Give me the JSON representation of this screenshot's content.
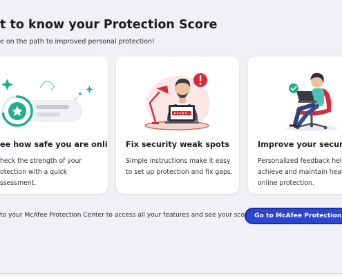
{
  "header": {
    "title": "t to know your Protection Score",
    "subtitle": "e on the path to improved personal protection!"
  },
  "cards": [
    {
      "heading": "ee how safe you are online",
      "body_lines": [
        "heck the strength of your",
        "otection with a quick",
        "ssessment."
      ],
      "illustration": "score-dial-icon"
    },
    {
      "heading": "Fix security weak spots",
      "body_lines": [
        "Simple instructions make it easy",
        "to set up protection and fix gaps."
      ],
      "illustration": "person-at-laptop-alert-icon"
    },
    {
      "heading": "Improve your security",
      "body_lines": [
        "Personalized feedback helps",
        "achieve and maintain health",
        "online protection."
      ],
      "illustration": "person-in-chair-with-laptop-icon"
    }
  ],
  "footer": {
    "text": "to your McAfee Protection Center to access all your features and see your score.",
    "button_label": "Go to McAfee Protection Cent"
  },
  "colors": {
    "background": "#f1f0f4",
    "card": "#ffffff",
    "accent_teal": "#1fae8e",
    "button": "#2c46cf",
    "alert_red": "#e0263a"
  }
}
